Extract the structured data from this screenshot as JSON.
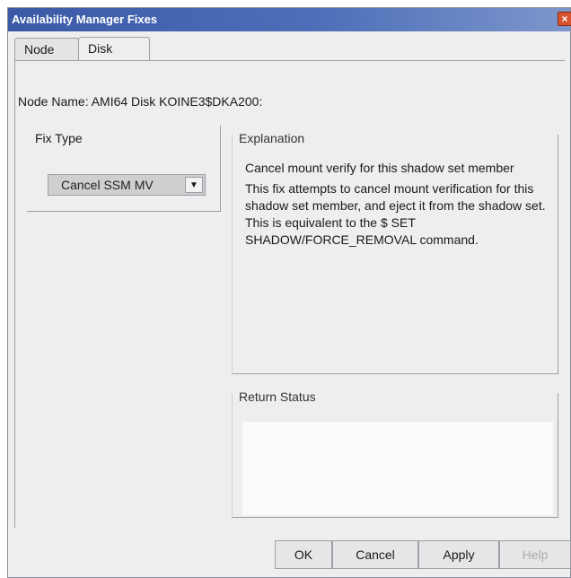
{
  "window": {
    "title": "Availability Manager Fixes",
    "close_glyph": "×"
  },
  "tabs": [
    {
      "label": "Node"
    },
    {
      "label": "Disk"
    }
  ],
  "node_info": "Node Name:  AMI64  Disk KOINE3$DKA200:",
  "fix_type": {
    "label": "Fix Type",
    "selected": "Cancel SSM MV",
    "arrow_glyph": "▼"
  },
  "explanation": {
    "label": "Explanation",
    "summary": "Cancel mount verify for this shadow set member",
    "detail": "This fix attempts to cancel mount verification for this shadow set member, and eject it from the shadow set. This is equivalent to the $ SET SHADOW/FORCE_REMOVAL command."
  },
  "return_status": {
    "label": "Return Status",
    "value": ""
  },
  "buttons": {
    "ok": "OK",
    "cancel": "Cancel",
    "apply": "Apply",
    "help": "Help"
  }
}
